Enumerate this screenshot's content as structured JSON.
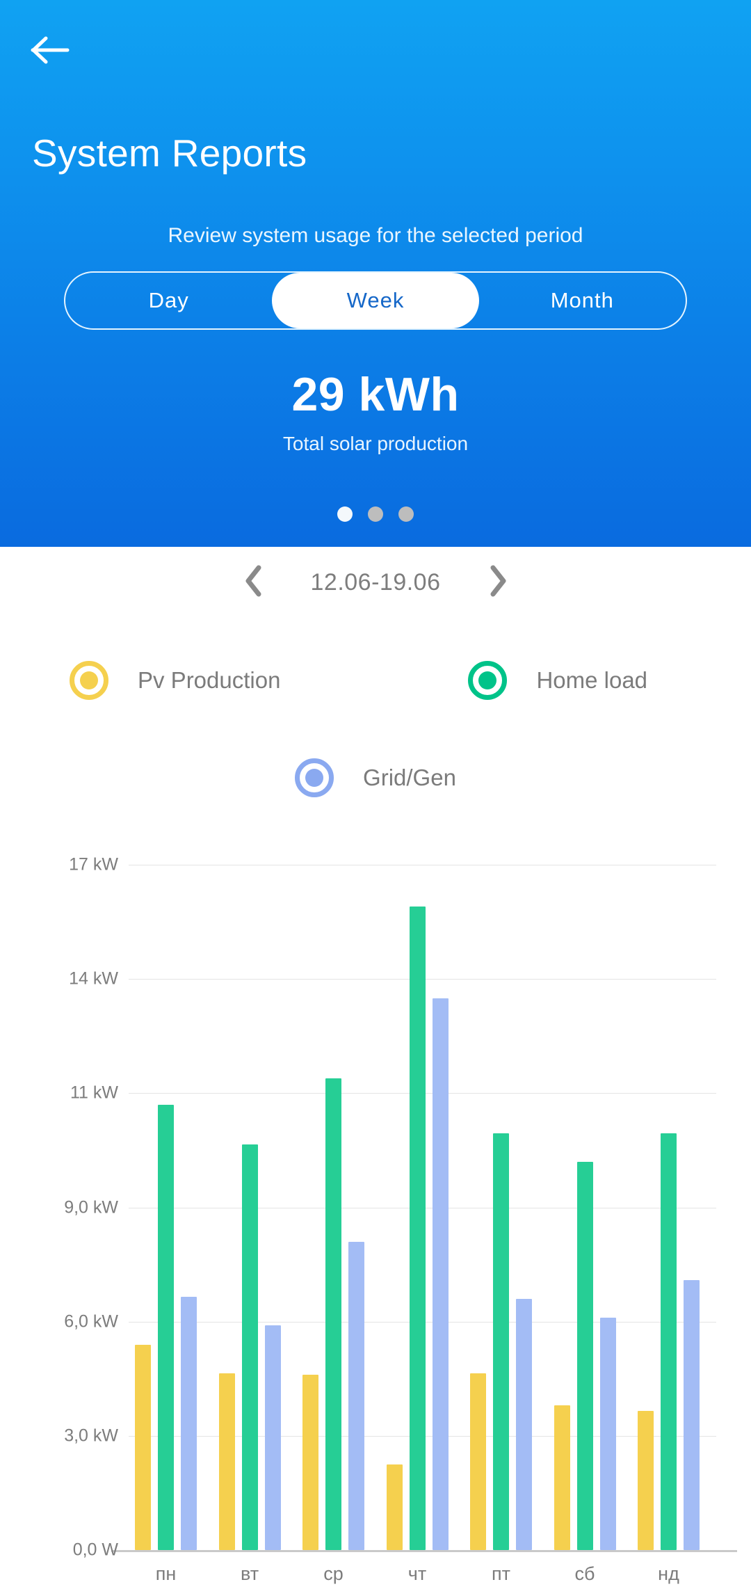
{
  "header": {
    "back_icon": "arrow-left-icon",
    "title": "System Reports",
    "subtitle": "Review system usage for the selected period",
    "gradient_top": "#10A2F2",
    "gradient_bottom": "#0A6BDF"
  },
  "period_selector": {
    "options": [
      {
        "label": "Day",
        "active": false
      },
      {
        "label": "Week",
        "active": true
      },
      {
        "label": "Month",
        "active": false
      }
    ]
  },
  "summary": {
    "value": "29 kWh",
    "caption": "Total solar production"
  },
  "pager": {
    "dots": [
      {
        "active": true
      },
      {
        "active": false
      },
      {
        "active": false
      }
    ]
  },
  "date_nav": {
    "prev_icon": "chevron-left-icon",
    "next_icon": "chevron-right-icon",
    "range": "12.06-19.06"
  },
  "legend": [
    {
      "label": "Pv Production",
      "color": "#F5D04E",
      "icon": "radio-selected-icon"
    },
    {
      "label": "Home load",
      "color": "#00C389",
      "icon": "radio-selected-icon"
    },
    {
      "label": "Grid/Gen",
      "color": "#8AA9F0",
      "icon": "radio-selected-icon"
    }
  ],
  "chart_data": {
    "type": "bar",
    "title": "",
    "xlabel": "",
    "ylabel": "",
    "grid": true,
    "legend_position": "above",
    "categories": [
      "пн",
      "вт",
      "ср",
      "чт",
      "пт",
      "сб",
      "нд"
    ],
    "ytick_labels": [
      "17 kW",
      "14 kW",
      "11 kW",
      "9,0 kW",
      "6,0 kW",
      "3,0 kW",
      "0,0 W"
    ],
    "ytick_values": [
      17,
      14,
      11,
      9,
      6,
      3,
      0
    ],
    "ylim": [
      0,
      17
    ],
    "series": [
      {
        "name": "Pv Production",
        "color": "#F5D04E",
        "values": [
          5.4,
          4.65,
          4.6,
          2.25,
          4.65,
          3.8,
          3.65
        ]
      },
      {
        "name": "Home load",
        "color": "#26CE95",
        "values": [
          10.8,
          10.1,
          11.4,
          15.9,
          10.3,
          9.8,
          10.3
        ]
      },
      {
        "name": "Grid/Gen",
        "color": "#A3BCF5",
        "values": [
          6.65,
          5.9,
          8.1,
          13.5,
          6.6,
          6.1,
          7.1
        ]
      }
    ]
  }
}
